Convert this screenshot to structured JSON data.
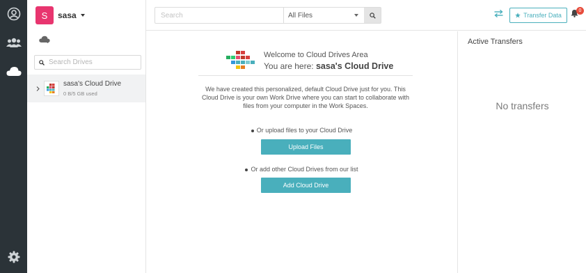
{
  "rail": {
    "items": [
      {
        "icon": "user-circle-icon"
      },
      {
        "icon": "users-icon"
      },
      {
        "icon": "cloud-icon"
      },
      {
        "icon": "gear-icon"
      }
    ]
  },
  "account": {
    "avatar_letter": "S",
    "name": "sasa",
    "avatar_color": "#e8356f"
  },
  "drives": {
    "search_placeholder": "Search Drives",
    "items": [
      {
        "name": "sasa's Cloud Drive",
        "usage": "0 B/5 GB used"
      }
    ]
  },
  "topbar": {
    "search_placeholder": "Search",
    "filter_value": "All Files",
    "transfer_label": "Transfer Data",
    "notification_count": "0"
  },
  "main": {
    "welcome_title": "Welcome to Cloud Drives Area",
    "location_prefix": "You are here:",
    "location_name": "sasa's Cloud Drive",
    "description": "We have created this personalized, default Cloud Drive just for you. This Cloud Drive is your own Work Drive where you can start to collaborate with files from your computer in the Work Spaces.",
    "upload_hint": "Or upload files to your Cloud Drive",
    "upload_button": "Upload Files",
    "add_hint": "Or add other Cloud Drives from our list",
    "add_button": "Add Cloud Drive"
  },
  "transfers": {
    "title": "Active Transfers",
    "empty_text": "No transfers"
  },
  "colors": {
    "accent": "#49afbc",
    "rail_bg": "#2b3338",
    "badge": "#e74c3c"
  }
}
